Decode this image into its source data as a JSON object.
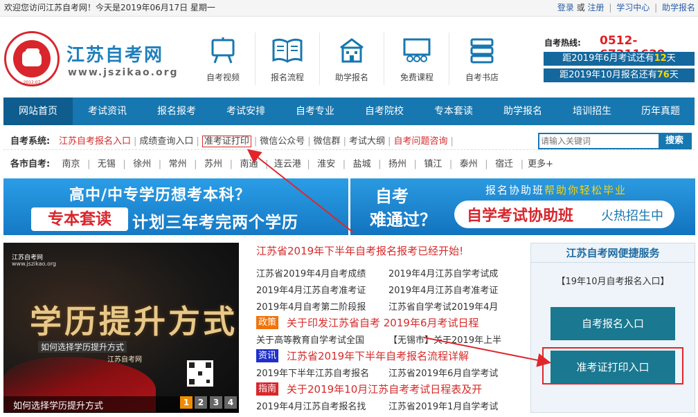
{
  "topbar": {
    "welcome": "欢迎您访问江苏自考网！今天是2019年06月17日 星期一",
    "login": "登录",
    "or": "或",
    "register": "注册",
    "sep": "|",
    "study_center": "学习中心",
    "help_apply": "助学报名"
  },
  "header": {
    "site_title": "江苏自考网",
    "site_url": "www.jszikao.org",
    "logo_ring": "2012.07",
    "nav_icons": [
      {
        "label": "自考视频",
        "icon": "easel-icon"
      },
      {
        "label": "报名流程",
        "icon": "book-icon"
      },
      {
        "label": "助学报名",
        "icon": "building-icon"
      },
      {
        "label": "免费课程",
        "icon": "classroom-icon"
      },
      {
        "label": "自考书店",
        "icon": "books-stack-icon"
      }
    ],
    "hotline_label": "自考热线:",
    "hotline_number": "0512-67311639",
    "countdown1": {
      "pre": "距2019年6月考试还有",
      "num": "12",
      "post": "天"
    },
    "countdown2": {
      "pre": "距2019年10月报名还有",
      "num": "76",
      "post": "天"
    }
  },
  "mainnav": [
    "网站首页",
    "考试资讯",
    "报名报考",
    "考试安排",
    "自考专业",
    "自考院校",
    "专本套读",
    "助学报名",
    "培训招生",
    "历年真题"
  ],
  "row1": {
    "label": "自考系统:",
    "links": [
      {
        "text": "江苏自考报名入口",
        "red": true
      },
      {
        "text": "成绩查询入口"
      },
      {
        "text": "准考证打印",
        "boxed": true
      },
      {
        "text": "微信公众号"
      },
      {
        "text": "微信群"
      },
      {
        "text": "考试大纲"
      },
      {
        "text": "自考问题咨询",
        "red": true
      }
    ]
  },
  "row2": {
    "label": "各市自考:",
    "cities": [
      "南京",
      "无锡",
      "徐州",
      "常州",
      "苏州",
      "南通",
      "连云港",
      "淮安",
      "盐城",
      "扬州",
      "镇江",
      "泰州",
      "宿迁",
      "更多+"
    ]
  },
  "search": {
    "placeholder": "请输入关键词",
    "button": "搜索"
  },
  "banner1": {
    "line1": "高中/中专学历想考本科？",
    "pill": "专本套读",
    "line2": "计划三年考完两个学历"
  },
  "banner2": {
    "q1": "自考",
    "q2": "难通过？",
    "top_pre": "报名协助班",
    "top_hl": "帮助你轻松毕业",
    "pill_a": "自学考试协助班",
    "pill_b": "火热招生中"
  },
  "slide": {
    "brand": "江苏自考网",
    "brand_url": "www.jszikao.org",
    "calligraphy": "学历提升方式",
    "sub": "江苏自考网",
    "overlay_title": "如何选择学历提升方式",
    "caption": "如何选择学历提升方式",
    "pages": [
      "1",
      "2",
      "3",
      "4"
    ],
    "active_page": 1
  },
  "news": {
    "headline": "江苏省2019年下半年自考报名报考已经开始!",
    "rows": [
      [
        "江苏省2019年4月自考成绩",
        "2019年4月江苏自学考试成"
      ],
      [
        "2019年4月江苏自考准考证",
        "2019年4月江苏自考准考证"
      ],
      [
        "2019年4月自考第二阶段报",
        "江苏省自学考试2019年4月"
      ]
    ],
    "tag1": {
      "tag": "政策",
      "text": "关于印发江苏省自考 2019年6月考试日程"
    },
    "row_after_tag1": [
      "关于高等教育自学考试全国",
      "【无锡市】关于2019年上半"
    ],
    "tag2": {
      "tag": "资讯",
      "text": "江苏省2019年下半年自考报名流程详解"
    },
    "row_after_tag2": [
      "2019年下半年江苏自考报名",
      "江苏省2019年6月自学考试"
    ],
    "tag3": {
      "tag": "指南",
      "text": "关于2019年10月江苏自考考试日程表及开"
    },
    "row_after_tag3": [
      "2019年4月江苏自考报名找",
      "江苏省2019年1月自学考试"
    ]
  },
  "panel": {
    "title": "江苏自考网便捷服务",
    "sub": "【19年10月自考报名入口】",
    "btn1": "自考报名入口",
    "btn2": "准考证打印入口"
  },
  "colors": {
    "brand_blue": "#1777b0",
    "accent_red": "#d8262c",
    "highlight_yellow": "#ffd400"
  }
}
